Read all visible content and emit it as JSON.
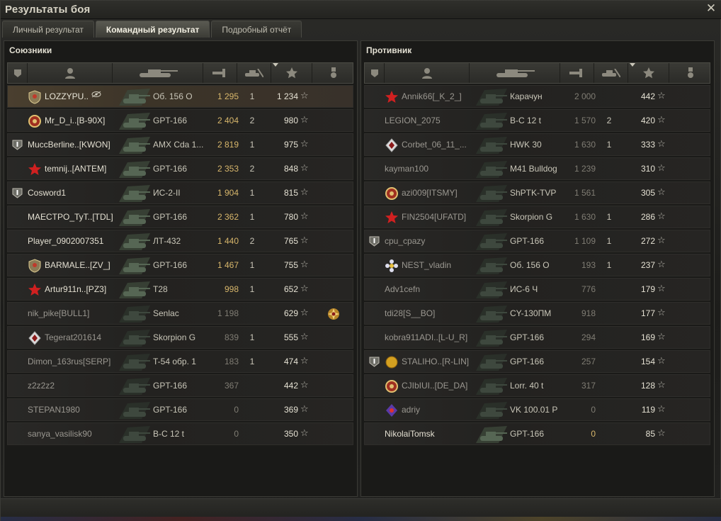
{
  "window": {
    "title": "Результаты боя"
  },
  "tabs": [
    {
      "label": "Личный результат",
      "active": false
    },
    {
      "label": "Командный результат",
      "active": true
    },
    {
      "label": "Подробный отчёт",
      "active": false
    }
  ],
  "allies": {
    "label": "Союзники",
    "rows": [
      {
        "name": "LOZZYPU..",
        "tank": "Об. 156 О",
        "damage": "1 295",
        "kills": "1",
        "xp": "1 234",
        "clan_icon": false,
        "badge": "shield-badge",
        "self": true,
        "dead": false
      },
      {
        "name": "Mr_D_i..[B-90X]",
        "tank": "GPT-166",
        "damage": "2 404",
        "kills": "2",
        "xp": "980",
        "clan_icon": false,
        "badge": "clan-emblem",
        "self": false,
        "dead": false
      },
      {
        "name": "MuccBerline..[KWON]",
        "tank": "AMX Cda 1...",
        "damage": "2 819",
        "kills": "1",
        "xp": "975",
        "clan_icon": true,
        "badge": "",
        "self": false,
        "dead": false
      },
      {
        "name": "temnij..[ANTEM]",
        "tank": "GPT-166",
        "damage": "2 353",
        "kills": "2",
        "xp": "848",
        "clan_icon": false,
        "badge": "red-star-emblem",
        "self": false,
        "dead": false
      },
      {
        "name": "Cosword1",
        "tank": "ИС-2-II",
        "damage": "1 904",
        "kills": "1",
        "xp": "815",
        "clan_icon": true,
        "badge": "",
        "self": false,
        "dead": false
      },
      {
        "name": "MAECTPO_TyT..[TDL]",
        "tank": "GPT-166",
        "damage": "2 362",
        "kills": "1",
        "xp": "780",
        "clan_icon": false,
        "badge": "",
        "self": false,
        "dead": false
      },
      {
        "name": "Player_0902007351",
        "tank": "ЛТ-432",
        "damage": "1 440",
        "kills": "2",
        "xp": "765",
        "clan_icon": false,
        "badge": "",
        "self": false,
        "dead": false
      },
      {
        "name": "BARMALE..[ZV_]",
        "tank": "GPT-166",
        "damage": "1 467",
        "kills": "1",
        "xp": "755",
        "clan_icon": false,
        "badge": "shield-badge",
        "self": false,
        "dead": false
      },
      {
        "name": "Artur911n..[PZ3]",
        "tank": "T28",
        "damage": "998",
        "kills": "1",
        "xp": "652",
        "clan_icon": false,
        "badge": "red-star-emblem",
        "self": false,
        "dead": false
      },
      {
        "name": "nik_pike[BULL1]",
        "tank": "Senlac",
        "damage": "1 198",
        "kills": "",
        "xp": "629",
        "clan_icon": false,
        "badge": "",
        "self": false,
        "dead": true,
        "medal": true
      },
      {
        "name": "Tegerat201614",
        "tank": "Skorpion G",
        "damage": "839",
        "kills": "1",
        "xp": "555",
        "clan_icon": false,
        "badge": "diamond-emblem",
        "self": false,
        "dead": true
      },
      {
        "name": "Dimon_163rus[SERP]",
        "tank": "T-54 обр. 1",
        "damage": "183",
        "kills": "1",
        "xp": "474",
        "clan_icon": false,
        "badge": "",
        "self": false,
        "dead": true
      },
      {
        "name": "z2z2z2",
        "tank": "GPT-166",
        "damage": "367",
        "kills": "",
        "xp": "442",
        "clan_icon": false,
        "badge": "",
        "self": false,
        "dead": true
      },
      {
        "name": "STEPAN1980",
        "tank": "GPT-166",
        "damage": "0",
        "kills": "",
        "xp": "369",
        "clan_icon": false,
        "badge": "",
        "self": false,
        "dead": true
      },
      {
        "name": "sanya_vasilisk90",
        "tank": "B-C 12 t",
        "damage": "0",
        "kills": "",
        "xp": "350",
        "clan_icon": false,
        "badge": "",
        "self": false,
        "dead": true
      }
    ]
  },
  "enemies": {
    "label": "Противник",
    "rows": [
      {
        "name": "Annik66[_K_2_]",
        "tank": "Карачун",
        "damage": "2 000",
        "kills": "",
        "xp": "442",
        "clan_icon": false,
        "badge": "red-star-emblem",
        "dead": true
      },
      {
        "name": "LEGION_2075",
        "tank": "B-C 12 t",
        "damage": "1 570",
        "kills": "2",
        "xp": "420",
        "clan_icon": false,
        "badge": "",
        "dead": true
      },
      {
        "name": "Corbet_06_11_...",
        "tank": "HWK 30",
        "damage": "1 630",
        "kills": "1",
        "xp": "333",
        "clan_icon": false,
        "badge": "diamond-emblem",
        "dead": true
      },
      {
        "name": "kayman100",
        "tank": "M41 Bulldog",
        "damage": "1 239",
        "kills": "",
        "xp": "310",
        "clan_icon": false,
        "badge": "",
        "dead": true
      },
      {
        "name": "azi009[ITSMY]",
        "tank": "ShPTK-TVP",
        "damage": "1 561",
        "kills": "",
        "xp": "305",
        "clan_icon": false,
        "badge": "clan-emblem",
        "dead": true
      },
      {
        "name": "FIN2504[UFATD]",
        "tank": "Skorpion G",
        "damage": "1 630",
        "kills": "1",
        "xp": "286",
        "clan_icon": false,
        "badge": "red-star-emblem",
        "dead": true
      },
      {
        "name": "cpu_cpazy",
        "tank": "GPT-166",
        "damage": "1 109",
        "kills": "1",
        "xp": "272",
        "clan_icon": true,
        "badge": "",
        "dead": true
      },
      {
        "name": "NEST_vladin",
        "tank": "Об. 156 О",
        "damage": "193",
        "kills": "1",
        "xp": "237",
        "clan_icon": false,
        "badge": "flower-emblem",
        "dead": true
      },
      {
        "name": "Adv1cefn",
        "tank": "ИС-6 Ч",
        "damage": "776",
        "kills": "",
        "xp": "179",
        "clan_icon": false,
        "badge": "",
        "dead": true
      },
      {
        "name": "tdi28[S__BO]",
        "tank": "CY-130ПМ",
        "damage": "918",
        "kills": "",
        "xp": "177",
        "clan_icon": false,
        "badge": "",
        "dead": true
      },
      {
        "name": "kobra911ADI..[L-U_R]",
        "tank": "GPT-166",
        "damage": "294",
        "kills": "",
        "xp": "169",
        "clan_icon": false,
        "badge": "",
        "dead": true
      },
      {
        "name": "STALIHO..[R-LIN]",
        "tank": "GPT-166",
        "damage": "257",
        "kills": "",
        "xp": "154",
        "clan_icon": true,
        "badge": "gold-emblem",
        "dead": true
      },
      {
        "name": "CJIbIUI..[DE_DA]",
        "tank": "Lorr. 40 t",
        "damage": "317",
        "kills": "",
        "xp": "128",
        "clan_icon": false,
        "badge": "clan-emblem",
        "dead": true
      },
      {
        "name": "adriy",
        "tank": "VK 100.01 P",
        "damage": "0",
        "kills": "",
        "xp": "119",
        "clan_icon": false,
        "badge": "purple-emblem",
        "dead": true
      },
      {
        "name": "NikolaiTomsk",
        "tank": "GPT-166",
        "damage": "0",
        "kills": "",
        "xp": "85",
        "clan_icon": false,
        "badge": "",
        "dead": false
      }
    ]
  },
  "star_glyph": "☆",
  "colors": {
    "damage_alive": "#d7b66b",
    "damage_dead": "#7f7c73",
    "self_row": "#4a3f2f"
  }
}
